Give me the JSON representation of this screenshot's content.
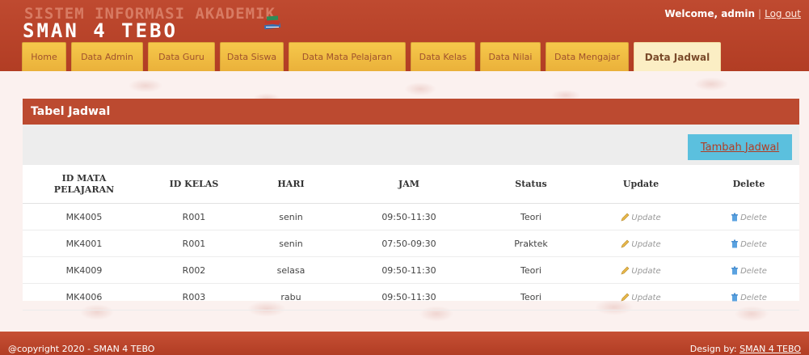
{
  "header": {
    "logo_line1": "SISTEM INFORMASI AKADEMIK",
    "logo_line2": "SMAN 4 TEBO",
    "welcome_text": "Welcome, admin",
    "logout_label": "Log out"
  },
  "nav": {
    "tabs": [
      {
        "label": "Home"
      },
      {
        "label": "Data Admin"
      },
      {
        "label": "Data Guru"
      },
      {
        "label": "Data Siswa"
      },
      {
        "label": "Data Mata Pelajaran"
      },
      {
        "label": "Data Kelas"
      },
      {
        "label": "Data Nilai"
      },
      {
        "label": "Data Mengajar"
      },
      {
        "label": "Data Jadwal"
      }
    ],
    "active": "Data Jadwal"
  },
  "panel": {
    "title": "Tabel Jadwal",
    "add_button": "Tambah Jadwal"
  },
  "table": {
    "headers": {
      "id_mapel_line1": "ID MATA",
      "id_mapel_line2": "PELAJARAN",
      "id_kelas": "ID KELAS",
      "hari": "HARI",
      "jam": "JAM",
      "status": "Status",
      "update": "Update",
      "delete": "Delete"
    },
    "rows": [
      {
        "id_mapel": "MK4005",
        "id_kelas": "R001",
        "hari": "senin",
        "jam": "09:50-11:30",
        "status": "Teori",
        "update": "Update",
        "delete": "Delete"
      },
      {
        "id_mapel": "MK4001",
        "id_kelas": "R001",
        "hari": "senin",
        "jam": "07:50-09:30",
        "status": "Praktek",
        "update": "Update",
        "delete": "Delete"
      },
      {
        "id_mapel": "MK4009",
        "id_kelas": "R002",
        "hari": "selasa",
        "jam": "09:50-11:30",
        "status": "Teori",
        "update": "Update",
        "delete": "Delete"
      },
      {
        "id_mapel": "MK4006",
        "id_kelas": "R003",
        "hari": "rabu",
        "jam": "09:50-11:30",
        "status": "Teori",
        "update": "Update",
        "delete": "Delete"
      }
    ]
  },
  "footer": {
    "copyright": "@copyright 2020 - SMAN 4 TEBO",
    "design_prefix": "Design by:",
    "design_link": "SMAN 4 TEBO"
  },
  "colors": {
    "header": "#b23d24",
    "tab": "#f6c84b",
    "tab_active": "#fbeec4",
    "button": "#5bc0de"
  },
  "icons": {
    "update": "pencil-icon",
    "delete": "trash-icon",
    "logo": "books-icon"
  }
}
